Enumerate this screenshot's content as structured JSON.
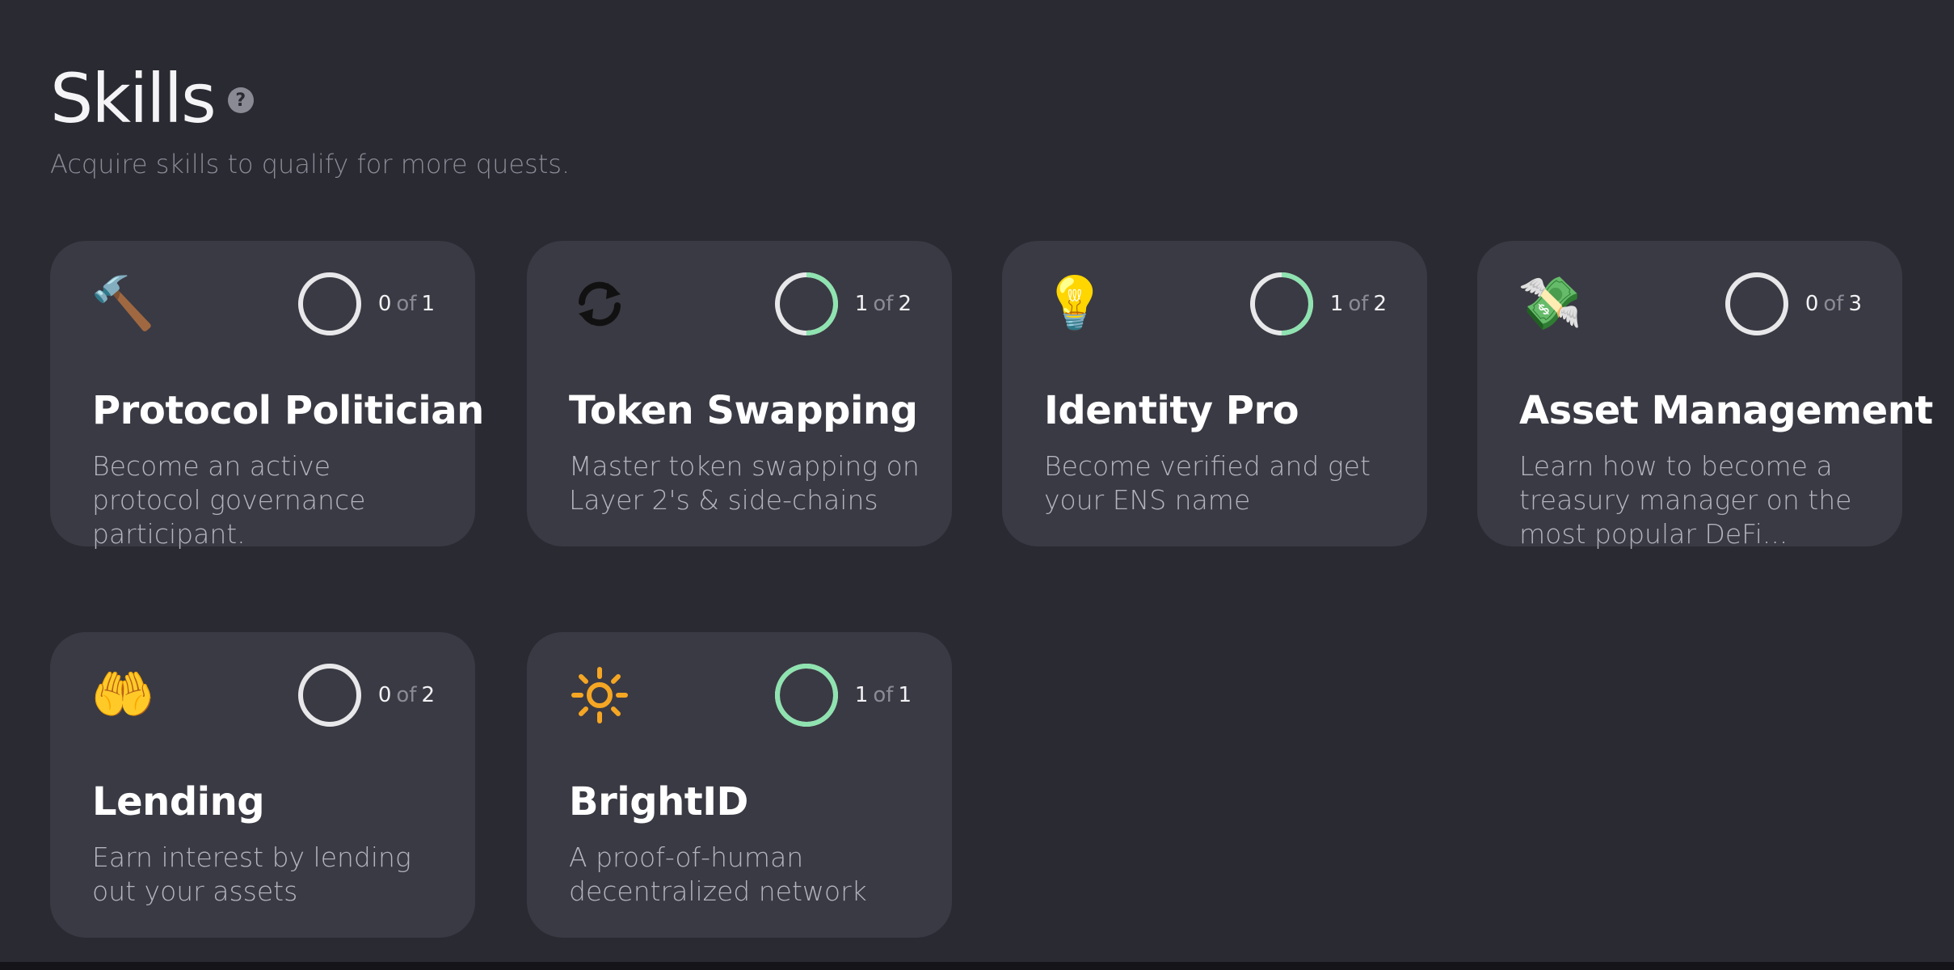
{
  "header": {
    "title": "Skills",
    "help_glyph": "?",
    "subtitle": "Acquire skills to qualify for more quests."
  },
  "colors": {
    "background": "#2a2a33",
    "card": "#3a3a44",
    "ring_track": "#e8e8ea",
    "ring_progress": "#8fe3b0"
  },
  "skills": [
    {
      "title": "Protocol Politician",
      "description": "Become an active protocol governance participant.",
      "icon": "gavel-icon",
      "glyph": "🔨",
      "done": "0",
      "of": "of",
      "total": "1",
      "progress": 0
    },
    {
      "title": "Token Swapping",
      "description": "Master token swapping on Layer 2's & side-chains",
      "icon": "swap-arrows-icon",
      "glyph": "🔄",
      "done": "1",
      "of": "of",
      "total": "2",
      "progress": 0.5
    },
    {
      "title": "Identity Pro",
      "description": "Become verified and get your ENS name",
      "icon": "lightbulb-icon",
      "glyph": "💡",
      "done": "1",
      "of": "of",
      "total": "2",
      "progress": 0.5
    },
    {
      "title": "Asset Management",
      "description": "Learn how to become a treasury manager on the most popular DeFi...",
      "icon": "money-with-wings-icon",
      "glyph": "💸",
      "done": "0",
      "of": "of",
      "total": "3",
      "progress": 0
    },
    {
      "title": "Lending",
      "description": "Earn interest by lending out your assets",
      "icon": "palms-up-icon",
      "glyph": "🤲",
      "done": "0",
      "of": "of",
      "total": "2",
      "progress": 0
    },
    {
      "title": "BrightID",
      "description": "A proof-of-human decentralized network",
      "icon": "sun-icon",
      "glyph": "☀",
      "done": "1",
      "of": "of",
      "total": "1",
      "progress": 1
    }
  ]
}
